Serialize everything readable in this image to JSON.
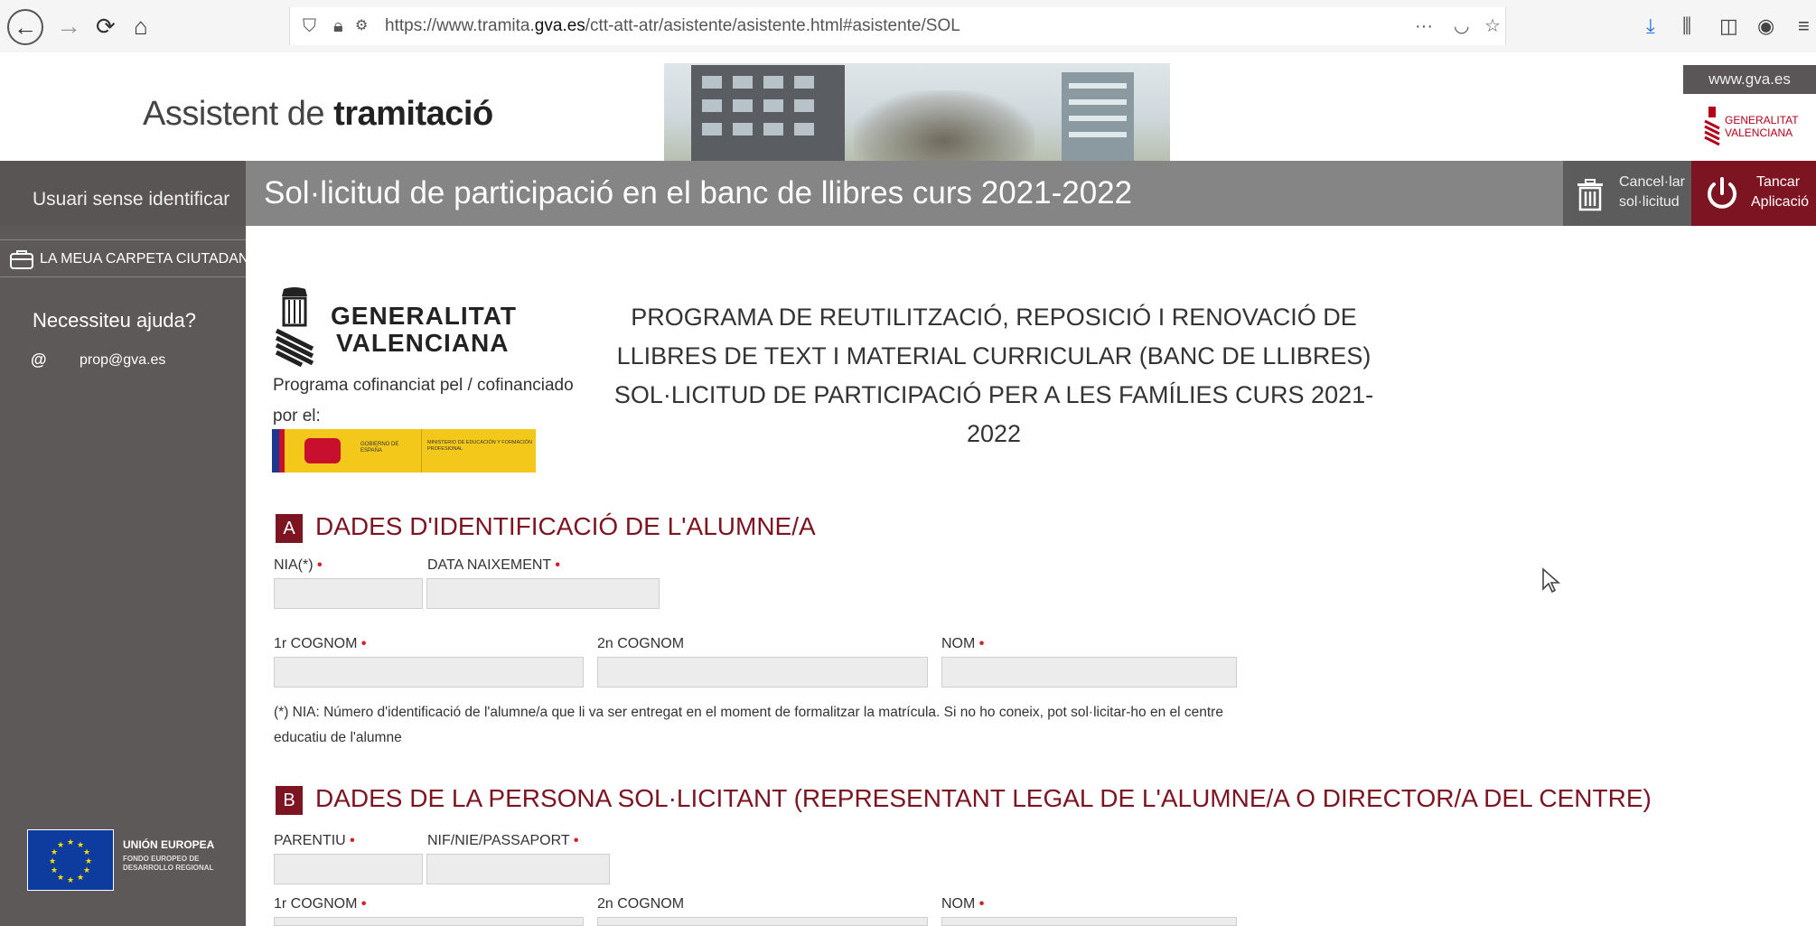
{
  "browser": {
    "url_prefix": "https://www.tramita.",
    "url_domain": "gva.es",
    "url_path": "/ctt-att-atr/asistente/asistente.html#asistente/SOL",
    "more_label": "···"
  },
  "header": {
    "title_light": "Assistent de",
    "title_bold": "tramitació",
    "gva_link": "www.gva.es",
    "gva_logo_line1": "GENERALITAT",
    "gva_logo_line2": "VALENCIANA"
  },
  "titlebar": {
    "user_status": "Usuari sense identificar",
    "page_title": "Sol·licitud de participació en el banc de llibres curs 2021-2022",
    "cancel_line1": "Cancel·lar",
    "cancel_line2": "sol·licitud",
    "close_line1": "Tancar",
    "close_line2": "Aplicació"
  },
  "sidebar": {
    "folder_link": "LA MEUA CARPETA CIUTADANA",
    "help_title": "Necessiteu ajuda?",
    "help_email": "prop@gva.es",
    "eu_title": "UNIÓN EUROPEA",
    "eu_sub": "FONDO EUROPEO DE DESARROLLO REGIONAL"
  },
  "form": {
    "logo_line1": "GENERALITAT",
    "logo_line2": "VALENCIANA",
    "cofinanced": "Programa cofinanciat pel / cofinanciado por el:",
    "ministry_left": "GOBIERNO DE ESPAÑA",
    "ministry_right": "MINISTERIO DE EDUCACIÓN Y FORMACIÓN PROFESIONAL",
    "program_title": "PROGRAMA DE REUTILITZACIÓ, REPOSICIÓ I RENOVACIÓ DE LLIBRES DE TEXT I MATERIAL CURRICULAR (BANC DE LLIBRES) SOL·LICITUD DE PARTICIPACIÓ PER A LES FAMÍLIES CURS 2021-2022",
    "section_a": {
      "letter": "A",
      "title": "DADES D'IDENTIFICACIÓ DE L'ALUMNE/A",
      "nia": "NIA(*)",
      "birth": "DATA NAIXEMENT",
      "surname1": "1r COGNOM",
      "surname2": "2n COGNOM",
      "name": "NOM",
      "note": "(*) NIA: Número d'identificació de l'alumne/a que li va ser entregat en el moment de formalitzar la matrícula. Si no ho coneix, pot sol·licitar-ho en el centre educatiu de l'alumne"
    },
    "section_b": {
      "letter": "B",
      "title": "DADES DE LA PERSONA SOL·LICITANT (REPRESENTANT LEGAL DE L'ALUMNE/A O DIRECTOR/A DEL CENTRE)",
      "kinship": "PARENTIU",
      "id": "NIF/NIE/PASSAPORT",
      "surname1": "1r COGNOM",
      "surname2": "2n COGNOM",
      "name": "NOM"
    },
    "required_mark": "•"
  }
}
